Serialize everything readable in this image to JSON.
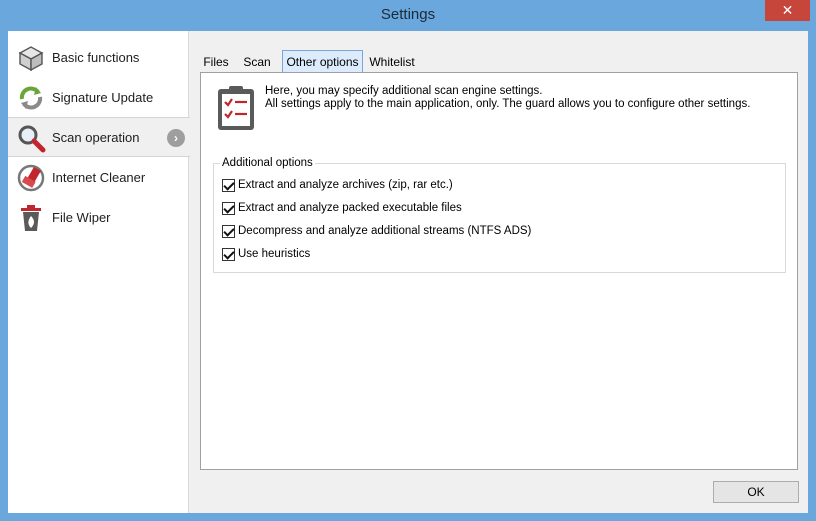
{
  "window": {
    "title": "Settings",
    "close_glyph": "✕"
  },
  "sidebar": {
    "items": [
      {
        "label": "Basic functions",
        "icon": "box-icon"
      },
      {
        "label": "Signature Update",
        "icon": "refresh-icon"
      },
      {
        "label": "Scan operation",
        "icon": "magnifier-icon",
        "active": true
      },
      {
        "label": "Internet Cleaner",
        "icon": "browser-broom-icon"
      },
      {
        "label": "File Wiper",
        "icon": "trash-fire-icon"
      }
    ],
    "arrow_glyph": "›"
  },
  "tabs": [
    {
      "label": "Files"
    },
    {
      "label": "Scan"
    },
    {
      "label": "Other options",
      "selected": true
    },
    {
      "label": "Whitelist"
    }
  ],
  "info": {
    "line1": "Here, you may specify additional scan engine settings.",
    "line2": "All settings apply to the main application, only. The guard allows you to configure other settings."
  },
  "group": {
    "title": "Additional options",
    "options": [
      {
        "label": "Extract and analyze archives (zip, rar etc.)",
        "checked": true
      },
      {
        "label": "Extract and analyze packed executable files",
        "checked": true
      },
      {
        "label": "Decompress and analyze additional streams (NTFS ADS)",
        "checked": true
      },
      {
        "label": "Use heuristics",
        "checked": true
      }
    ]
  },
  "buttons": {
    "ok": "OK"
  },
  "colors": {
    "titlebar": "#6aa7dd",
    "close": "#c7463b",
    "accent_red": "#c0262c"
  }
}
